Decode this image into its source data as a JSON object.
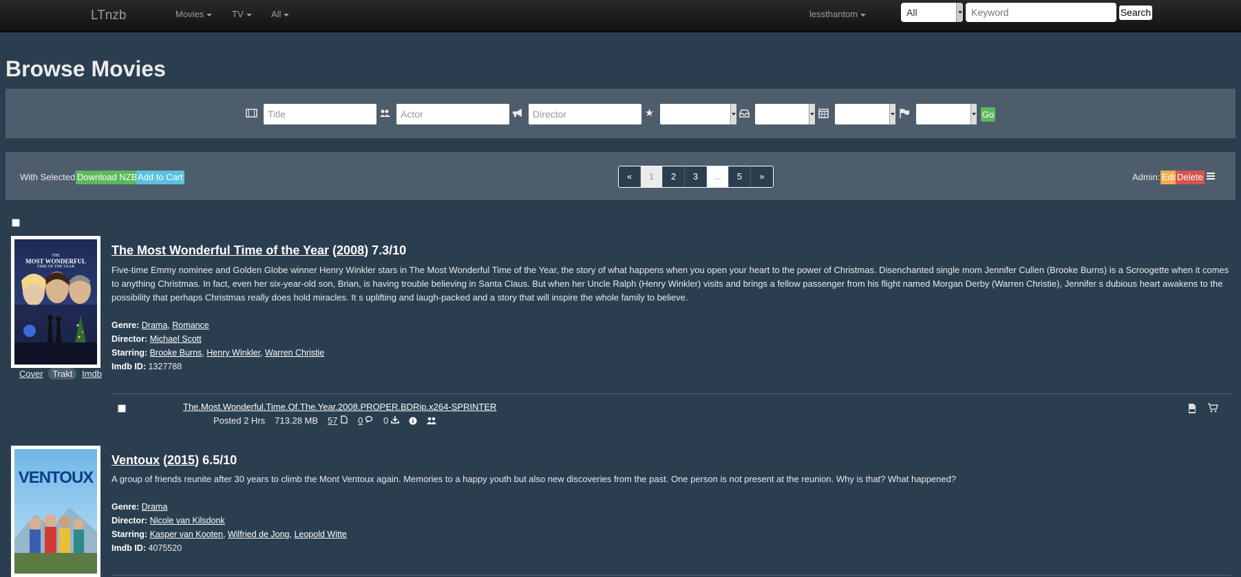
{
  "nav": {
    "brand": "LTnzb",
    "menus": [
      "Movies",
      "TV",
      "All"
    ],
    "user": "lessthantom",
    "category_selected": "All",
    "keyword_placeholder": "Keyword",
    "search_label": "Search"
  },
  "page_title": "Browse Movies",
  "filters": {
    "title_placeholder": "Title",
    "actor_placeholder": "Actor",
    "director_placeholder": "Director",
    "go_label": "Go",
    "icons": [
      "film-icon",
      "users-icon",
      "bullhorn-icon",
      "star-icon",
      "inbox-icon",
      "calendar-icon",
      "flag-icon"
    ]
  },
  "actions": {
    "with_selected": "With Selected:",
    "download_label": "Download NZBs",
    "cart_label": "Add to Cart",
    "admin_label": "Admin:",
    "edit_label": "Edit",
    "delete_label": "Delete"
  },
  "pagination": [
    "«",
    "1",
    "2",
    "3",
    "...",
    "5",
    "»"
  ],
  "movies": [
    {
      "title": "The Most Wonderful Time of the Year",
      "year": "2008",
      "rating": "7.3/10",
      "plot": "Five-time Emmy nominee and Golden Globe winner Henry Winkler stars in The Most Wonderful Time of the Year, the story of what happens when you open your heart to the power of Christmas. Disenchanted single mom Jennifer Cullen (Brooke Burns) is a Scroogette when it comes to anything Christmas. In fact, even her six-year-old son, Brian, is having trouble believing in Santa Claus. But when her Uncle Ralph (Henry Winkler) visits and brings a fellow passenger from his flight named Morgan Derby (Warren Christie), Jennifer s dubious heart awakens to the possibility that perhaps Christmas really does hold miracles. It s uplifting and laugh-packed and a story that will inspire the whole family to believe.",
      "genre_label": "Genre:",
      "genres": [
        "Drama",
        "Romance"
      ],
      "director_label": "Director:",
      "director": "Michael Scott",
      "starring_label": "Starring:",
      "starring": [
        "Brooke Burns",
        "Henry Winkler",
        "Warren Christie"
      ],
      "imdb_label": "Imdb ID:",
      "imdb_id": "1327788",
      "poster_title_1": "THE",
      "poster_title_2": "MOST WONDERFUL",
      "poster_title_3": "TIME OF THE YEAR",
      "links": [
        "Cover",
        "Trakt",
        "Imdb"
      ],
      "release": {
        "name": "The.Most.Wonderful.Time.Of.The.Year.2008.PROPER.BDRip.x264-SPRINTER",
        "posted": "Posted 2 Hrs",
        "size": "713.28 MB",
        "files": "57",
        "comments": "0",
        "downloads": "0"
      }
    },
    {
      "title": "Ventoux",
      "year": "2015",
      "rating": "6.5/10",
      "plot": "A group of friends reunite after 30 years to climb the Mont Ventoux again. Memories to a happy youth but also new discoveries from the past. One person is not present at the reunion. Why is that? What happened?",
      "genre_label": "Genre:",
      "genres": [
        "Drama"
      ],
      "director_label": "Director:",
      "director": "Nicole van Kilsdonk",
      "starring_label": "Starring:",
      "starring": [
        "Kasper van Kooten",
        "Wilfried de Jong",
        "Leopold Witte"
      ],
      "imdb_label": "Imdb ID:",
      "imdb_id": "4075520",
      "poster_title": "VENTOUX"
    }
  ]
}
